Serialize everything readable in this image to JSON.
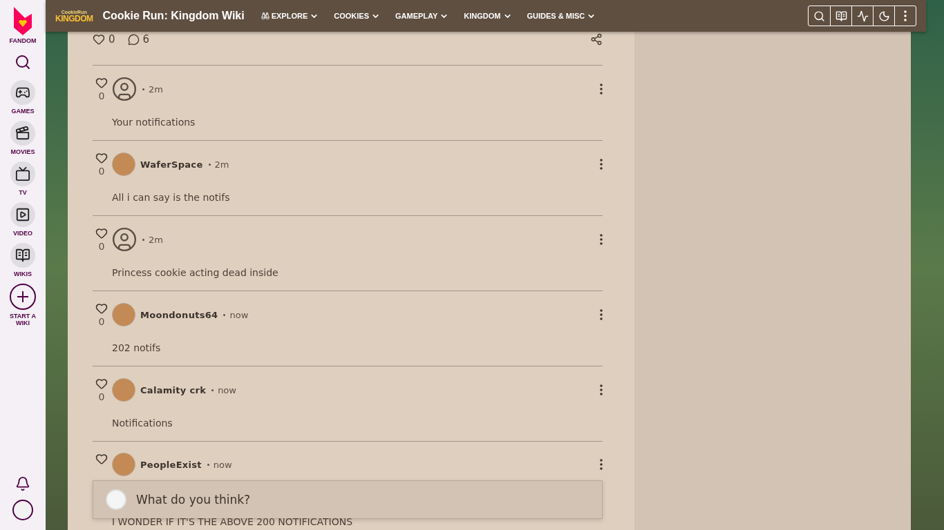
{
  "sidebar": {
    "brand": "FANDOM",
    "items": [
      {
        "label": "GAMES",
        "kind": "games"
      },
      {
        "label": "MOVIES",
        "kind": "movies"
      },
      {
        "label": "TV",
        "kind": "tv"
      },
      {
        "label": "VIDEO",
        "kind": "video"
      },
      {
        "label": "WIKIS",
        "kind": "wikis"
      },
      {
        "label": "START A WIKI",
        "kind": "start"
      }
    ]
  },
  "header": {
    "logo_top": "CookieRun",
    "logo_main": "KINGDOM",
    "title": "Cookie Run: Kingdom Wiki",
    "nav": [
      {
        "label": "EXPLORE",
        "kind": "explore"
      },
      {
        "label": "COOKIES",
        "kind": "plain"
      },
      {
        "label": "GAMEPLAY",
        "kind": "plain"
      },
      {
        "label": "KINGDOM",
        "kind": "plain"
      },
      {
        "label": "GUIDES & MISC",
        "kind": "plain"
      }
    ]
  },
  "reactions": {
    "likes": "0",
    "comments": "6"
  },
  "comments": [
    {
      "kind": "anonymous",
      "time": "2m",
      "likes": "0",
      "text": "Your notifications"
    },
    {
      "kind": "user",
      "name": "WaferSpace",
      "time": "2m",
      "likes": "0",
      "text": "All i can say is the notifs"
    },
    {
      "kind": "anonymous",
      "time": "2m",
      "likes": "0",
      "text": "Princess cookie acting dead inside"
    },
    {
      "kind": "user",
      "name": "Moondonuts64",
      "time": "now",
      "likes": "0",
      "text": "202 notifs"
    },
    {
      "kind": "user",
      "name": "Calamity crk",
      "time": "now",
      "likes": "0",
      "text": "Notifications"
    },
    {
      "kind": "user",
      "name": "PeopleExist",
      "time": "now",
      "text": "I WONDER IF IT'S THE ABOVE 200 NOTIFICATIONS"
    }
  ],
  "composer": {
    "placeholder": "What do you think?"
  }
}
